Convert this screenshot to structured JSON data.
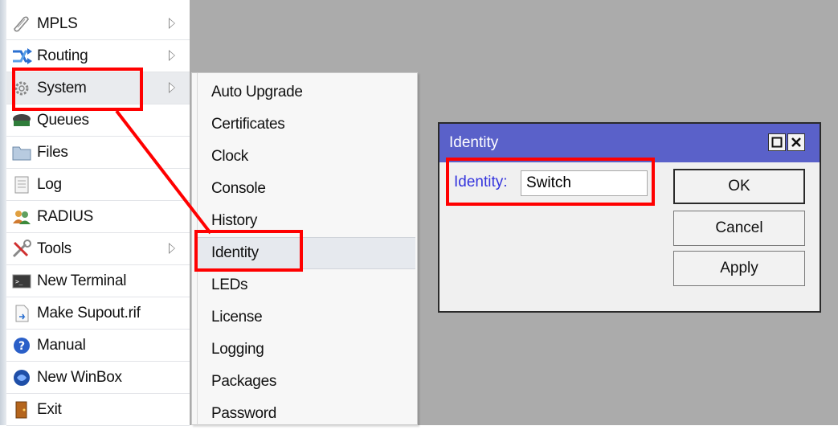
{
  "left_menu": {
    "items": [
      {
        "label": "MPLS",
        "icon": "mpls-icon",
        "submenu": true
      },
      {
        "label": "Routing",
        "icon": "routing-icon",
        "submenu": true
      },
      {
        "label": "System",
        "icon": "gear-icon",
        "submenu": true
      },
      {
        "label": "Queues",
        "icon": "queues-icon",
        "submenu": false
      },
      {
        "label": "Files",
        "icon": "folder-icon",
        "submenu": false
      },
      {
        "label": "Log",
        "icon": "log-icon",
        "submenu": false
      },
      {
        "label": "RADIUS",
        "icon": "users-icon",
        "submenu": false
      },
      {
        "label": "Tools",
        "icon": "tools-icon",
        "submenu": true
      },
      {
        "label": "New Terminal",
        "icon": "terminal-icon",
        "submenu": false
      },
      {
        "label": "Make Supout.rif",
        "icon": "file-icon",
        "submenu": false
      },
      {
        "label": "Manual",
        "icon": "help-icon",
        "submenu": false
      },
      {
        "label": "New WinBox",
        "icon": "winbox-icon",
        "submenu": false
      },
      {
        "label": "Exit",
        "icon": "exit-icon",
        "submenu": false
      }
    ]
  },
  "submenu": {
    "items": [
      "Auto Upgrade",
      "Certificates",
      "Clock",
      "Console",
      "History",
      "Identity",
      "LEDs",
      "License",
      "Logging",
      "Packages",
      "Password"
    ]
  },
  "dialog": {
    "title": "Identity",
    "field_label": "Identity:",
    "field_value": "Switch",
    "buttons": {
      "ok": "OK",
      "cancel": "Cancel",
      "apply": "Apply"
    }
  },
  "colors": {
    "highlight": "#ff0000",
    "titlebar": "#5a61c9",
    "label": "#3333dd"
  }
}
